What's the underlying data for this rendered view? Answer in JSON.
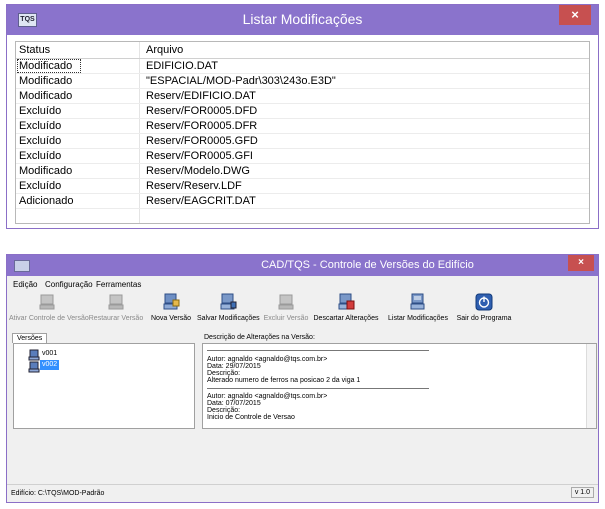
{
  "dialog": {
    "app_icon_text": "TQS",
    "title": "Listar Modificações",
    "close": "×",
    "columns": [
      "Status",
      "Arquivo"
    ],
    "rows": [
      {
        "status": "Modificado",
        "file": "EDIFICIO.DAT"
      },
      {
        "status": "Modificado",
        "file": "\"ESPACIAL/MOD-Padr\\303\\243o.E3D\""
      },
      {
        "status": "Modificado",
        "file": "Reserv/EDIFICIO.DAT"
      },
      {
        "status": "Excluído",
        "file": "Reserv/FOR0005.DFD"
      },
      {
        "status": "Excluído",
        "file": "Reserv/FOR0005.DFR"
      },
      {
        "status": "Excluído",
        "file": "Reserv/FOR0005.GFD"
      },
      {
        "status": "Excluído",
        "file": "Reserv/FOR0005.GFI"
      },
      {
        "status": "Modificado",
        "file": "Reserv/Modelo.DWG"
      },
      {
        "status": "Excluído",
        "file": "Reserv/Reserv.LDF"
      },
      {
        "status": "Adicionado",
        "file": "Reserv/EAGCRIT.DAT"
      }
    ]
  },
  "main": {
    "title": "CAD/TQS - Controle de Versões do Edifício",
    "close": "×",
    "menu": [
      "Edição",
      "Configuração",
      "Ferramentas"
    ],
    "toolbar": [
      {
        "label": "Ativar Controle de Versão",
        "icon": "computer-icon",
        "enabled": false
      },
      {
        "label": "Restaurar Versão",
        "icon": "computer-icon",
        "enabled": false
      },
      {
        "label": "Nova Versão",
        "icon": "new-version-icon",
        "enabled": true
      },
      {
        "label": "Salvar Modificações",
        "icon": "save-icon",
        "enabled": true
      },
      {
        "label": "Excluir Versão",
        "icon": "delete-icon",
        "enabled": false
      },
      {
        "label": "Descartar Alterações",
        "icon": "discard-icon",
        "enabled": true
      },
      {
        "label": "Listar Modificações",
        "icon": "list-icon",
        "enabled": true
      },
      {
        "label": "Sair do Programa",
        "icon": "power-icon",
        "enabled": true
      }
    ],
    "tab": "Versões",
    "tree": [
      "v001",
      "v002"
    ],
    "desc_header": "Descrição de Alterações na Versão:",
    "entries": [
      {
        "author": "Autor: agnaldo <agnaldo@tqs.com.br>",
        "date": "Data: 29/07/2015",
        "desc_label": "Descrição:",
        "desc": "Alterado numero de ferros na posicao 2 da viga 1"
      },
      {
        "author": "Autor: agnaldo <agnaldo@tqs.com.br>",
        "date": "Data: 07/07/2015",
        "desc_label": "Descrição:",
        "desc": "Inicio de Controle de Versao"
      }
    ],
    "status": "Edifício: C:\\TQS\\MOD-Padrão",
    "version": "v 1.0"
  },
  "colors": {
    "titlebar": "#8a73cc",
    "close": "#c75050",
    "selection": "#3390ff"
  }
}
